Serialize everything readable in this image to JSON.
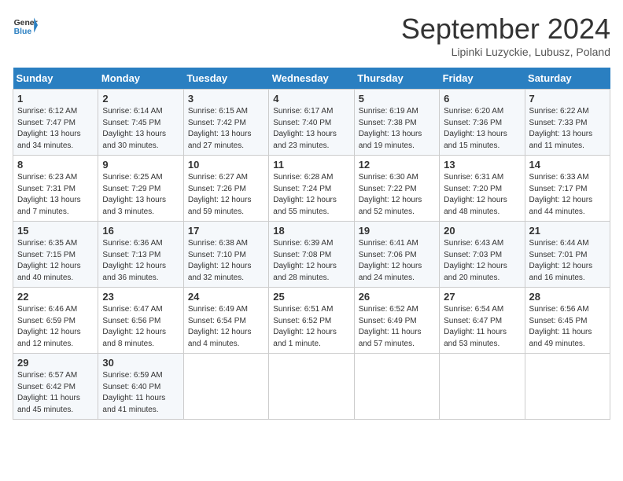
{
  "header": {
    "logo_line1": "General",
    "logo_line2": "Blue",
    "month": "September 2024",
    "location": "Lipinki Luzyckie, Lubusz, Poland"
  },
  "days_of_week": [
    "Sunday",
    "Monday",
    "Tuesday",
    "Wednesday",
    "Thursday",
    "Friday",
    "Saturday"
  ],
  "weeks": [
    [
      {
        "day": "1",
        "content": "Sunrise: 6:12 AM\nSunset: 7:47 PM\nDaylight: 13 hours\nand 34 minutes."
      },
      {
        "day": "2",
        "content": "Sunrise: 6:14 AM\nSunset: 7:45 PM\nDaylight: 13 hours\nand 30 minutes."
      },
      {
        "day": "3",
        "content": "Sunrise: 6:15 AM\nSunset: 7:42 PM\nDaylight: 13 hours\nand 27 minutes."
      },
      {
        "day": "4",
        "content": "Sunrise: 6:17 AM\nSunset: 7:40 PM\nDaylight: 13 hours\nand 23 minutes."
      },
      {
        "day": "5",
        "content": "Sunrise: 6:19 AM\nSunset: 7:38 PM\nDaylight: 13 hours\nand 19 minutes."
      },
      {
        "day": "6",
        "content": "Sunrise: 6:20 AM\nSunset: 7:36 PM\nDaylight: 13 hours\nand 15 minutes."
      },
      {
        "day": "7",
        "content": "Sunrise: 6:22 AM\nSunset: 7:33 PM\nDaylight: 13 hours\nand 11 minutes."
      }
    ],
    [
      {
        "day": "8",
        "content": "Sunrise: 6:23 AM\nSunset: 7:31 PM\nDaylight: 13 hours\nand 7 minutes."
      },
      {
        "day": "9",
        "content": "Sunrise: 6:25 AM\nSunset: 7:29 PM\nDaylight: 13 hours\nand 3 minutes."
      },
      {
        "day": "10",
        "content": "Sunrise: 6:27 AM\nSunset: 7:26 PM\nDaylight: 12 hours\nand 59 minutes."
      },
      {
        "day": "11",
        "content": "Sunrise: 6:28 AM\nSunset: 7:24 PM\nDaylight: 12 hours\nand 55 minutes."
      },
      {
        "day": "12",
        "content": "Sunrise: 6:30 AM\nSunset: 7:22 PM\nDaylight: 12 hours\nand 52 minutes."
      },
      {
        "day": "13",
        "content": "Sunrise: 6:31 AM\nSunset: 7:20 PM\nDaylight: 12 hours\nand 48 minutes."
      },
      {
        "day": "14",
        "content": "Sunrise: 6:33 AM\nSunset: 7:17 PM\nDaylight: 12 hours\nand 44 minutes."
      }
    ],
    [
      {
        "day": "15",
        "content": "Sunrise: 6:35 AM\nSunset: 7:15 PM\nDaylight: 12 hours\nand 40 minutes."
      },
      {
        "day": "16",
        "content": "Sunrise: 6:36 AM\nSunset: 7:13 PM\nDaylight: 12 hours\nand 36 minutes."
      },
      {
        "day": "17",
        "content": "Sunrise: 6:38 AM\nSunset: 7:10 PM\nDaylight: 12 hours\nand 32 minutes."
      },
      {
        "day": "18",
        "content": "Sunrise: 6:39 AM\nSunset: 7:08 PM\nDaylight: 12 hours\nand 28 minutes."
      },
      {
        "day": "19",
        "content": "Sunrise: 6:41 AM\nSunset: 7:06 PM\nDaylight: 12 hours\nand 24 minutes."
      },
      {
        "day": "20",
        "content": "Sunrise: 6:43 AM\nSunset: 7:03 PM\nDaylight: 12 hours\nand 20 minutes."
      },
      {
        "day": "21",
        "content": "Sunrise: 6:44 AM\nSunset: 7:01 PM\nDaylight: 12 hours\nand 16 minutes."
      }
    ],
    [
      {
        "day": "22",
        "content": "Sunrise: 6:46 AM\nSunset: 6:59 PM\nDaylight: 12 hours\nand 12 minutes."
      },
      {
        "day": "23",
        "content": "Sunrise: 6:47 AM\nSunset: 6:56 PM\nDaylight: 12 hours\nand 8 minutes."
      },
      {
        "day": "24",
        "content": "Sunrise: 6:49 AM\nSunset: 6:54 PM\nDaylight: 12 hours\nand 4 minutes."
      },
      {
        "day": "25",
        "content": "Sunrise: 6:51 AM\nSunset: 6:52 PM\nDaylight: 12 hours\nand 1 minute."
      },
      {
        "day": "26",
        "content": "Sunrise: 6:52 AM\nSunset: 6:49 PM\nDaylight: 11 hours\nand 57 minutes."
      },
      {
        "day": "27",
        "content": "Sunrise: 6:54 AM\nSunset: 6:47 PM\nDaylight: 11 hours\nand 53 minutes."
      },
      {
        "day": "28",
        "content": "Sunrise: 6:56 AM\nSunset: 6:45 PM\nDaylight: 11 hours\nand 49 minutes."
      }
    ],
    [
      {
        "day": "29",
        "content": "Sunrise: 6:57 AM\nSunset: 6:42 PM\nDaylight: 11 hours\nand 45 minutes."
      },
      {
        "day": "30",
        "content": "Sunrise: 6:59 AM\nSunset: 6:40 PM\nDaylight: 11 hours\nand 41 minutes."
      },
      {
        "day": "",
        "content": ""
      },
      {
        "day": "",
        "content": ""
      },
      {
        "day": "",
        "content": ""
      },
      {
        "day": "",
        "content": ""
      },
      {
        "day": "",
        "content": ""
      }
    ]
  ]
}
